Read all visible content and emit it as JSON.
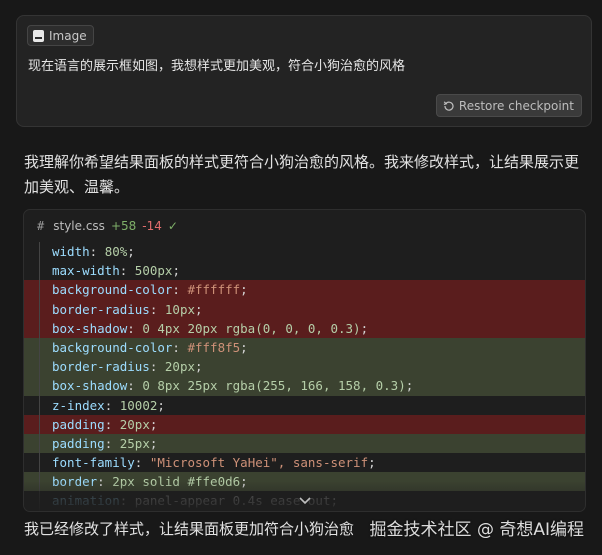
{
  "user_message": {
    "attachment_label": "Image",
    "text": "现在语言的展示框如图，我想样式更加美观，符合小狗治愈的风格",
    "restore_button_label": "Restore checkpoint"
  },
  "assistant": {
    "reply_text": "我理解你希望结果面板的样式更符合小狗治愈的风格。我来修改样式，让结果展示更加美观、温馨。",
    "bottom_text": "我已经修改了样式，让结果面板更加符合小狗治愈"
  },
  "code_block": {
    "filename": "style.css",
    "added": "+58",
    "removed": "-14",
    "lines": [
      {
        "type": "ctx",
        "prop": "width",
        "value": "80%",
        "vclass": "num"
      },
      {
        "type": "ctx",
        "prop": "max-width",
        "value": "500px",
        "vclass": "num"
      },
      {
        "type": "del",
        "prop": "background-color",
        "value": "#ffffff",
        "vclass": "str"
      },
      {
        "type": "del",
        "prop": "border-radius",
        "value": "10px",
        "vclass": "num"
      },
      {
        "type": "del",
        "prop": "box-shadow",
        "value": "0 4px 20px rgba(0, 0, 0, 0.3)",
        "vclass": "num"
      },
      {
        "type": "add",
        "prop": "background-color",
        "value": "#fff8f5",
        "vclass": "str"
      },
      {
        "type": "add",
        "prop": "border-radius",
        "value": "20px",
        "vclass": "num"
      },
      {
        "type": "add",
        "prop": "box-shadow",
        "value": "0 8px 25px rgba(255, 166, 158, 0.3)",
        "vclass": "num"
      },
      {
        "type": "ctx",
        "prop": "z-index",
        "value": "10002",
        "vclass": "num"
      },
      {
        "type": "del",
        "prop": "padding",
        "value": "20px",
        "vclass": "num"
      },
      {
        "type": "add",
        "prop": "padding",
        "value": "25px",
        "vclass": "num"
      },
      {
        "type": "ctx",
        "prop": "font-family",
        "value": "\"Microsoft YaHei\", sans-serif",
        "vclass": "str"
      },
      {
        "type": "add",
        "prop": "border",
        "value": "2px solid #ffe0d6",
        "vclass": "num"
      },
      {
        "type": "fade",
        "prop": "animation",
        "value": "panel-appear 0.4s ease-out",
        "vclass": "plain"
      }
    ]
  },
  "watermark": "掘金技术社区 @ 奇想AI编程",
  "icons": {
    "attachment": "image-icon",
    "restore": "restore-icon",
    "check": "check-icon",
    "expand": "chevron-down-icon"
  }
}
